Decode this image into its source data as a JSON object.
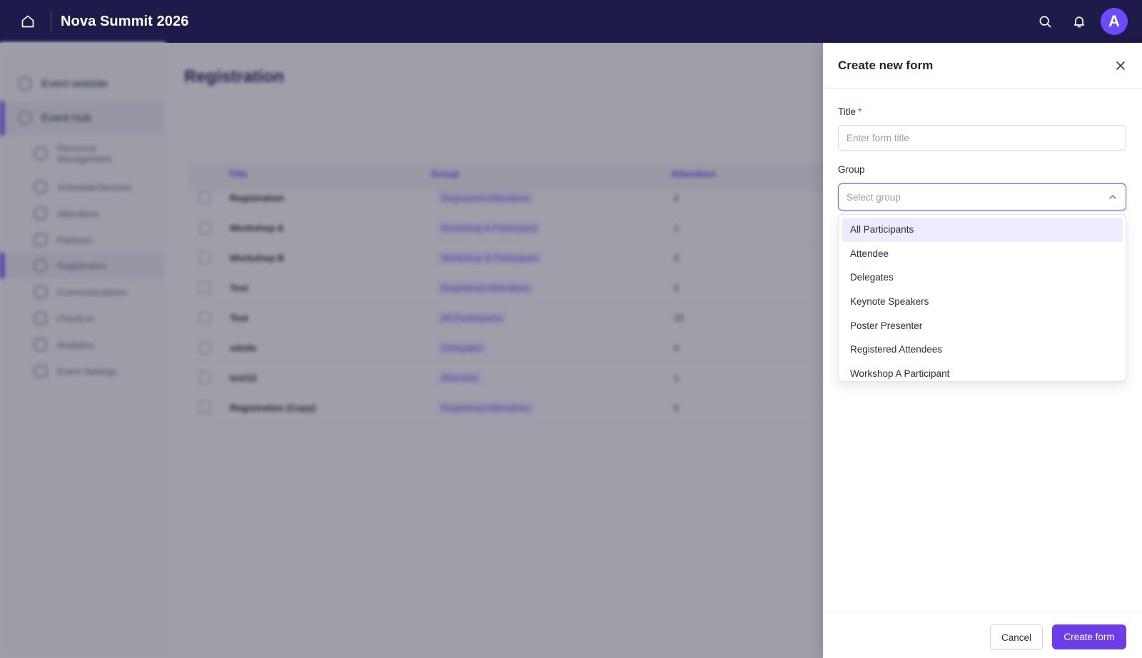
{
  "topbar": {
    "title": "Nova Summit 2026",
    "avatar_initial": "A",
    "icons": {
      "home": "home-icon",
      "search": "search-icon",
      "notifications": "bell-icon"
    }
  },
  "background": {
    "page_title": "Registration",
    "sidebar": {
      "top_items": [
        "Event website",
        "Event Hub"
      ],
      "sub_items": [
        "Resource Management",
        "Schedule/Session",
        "Attendees",
        "Partners",
        "Registration",
        "Communications",
        "Check-in",
        "Analytics",
        "Event Settings"
      ]
    },
    "table": {
      "headers": [
        "Title",
        "Group",
        "Attendees"
      ],
      "rows": [
        {
          "title": "Registration",
          "group": "Registered Attendees",
          "attendees": "2"
        },
        {
          "title": "Workshop A",
          "group": "Workshop A Participant",
          "attendees": "1"
        },
        {
          "title": "Workshop B",
          "group": "Workshop B Participant",
          "attendees": "0"
        },
        {
          "title": "Test",
          "group": "Registered Attendees",
          "attendees": "0"
        },
        {
          "title": "Test",
          "group": "All Participants",
          "attendees": "15"
        },
        {
          "title": "sdsds",
          "group": "Delegates",
          "attendees": "0"
        },
        {
          "title": "test12",
          "group": "Attendee",
          "attendees": "1"
        },
        {
          "title": "Registration (Copy)",
          "group": "Registered Attendees",
          "attendees": "0"
        }
      ]
    }
  },
  "drawer": {
    "title": "Create new form",
    "title_field": {
      "label": "Title",
      "required_mark": "*",
      "placeholder": "Enter form title",
      "value": ""
    },
    "group_field": {
      "label": "Group",
      "placeholder": "Select group",
      "highlighted_index": 0,
      "options": [
        "All Participants",
        "Attendee",
        "Delegates",
        "Keynote Speakers",
        "Poster Presenter",
        "Registered Attendees",
        "Workshop A Participant"
      ]
    },
    "footer": {
      "cancel_label": "Cancel",
      "create_label": "Create form"
    }
  },
  "colors": {
    "topbar_bg": "#1e1b4b",
    "accent": "#6d3ee8",
    "focus_border": "#7c5cff",
    "highlight_bg": "#efebff",
    "required": "#e23d4f"
  }
}
